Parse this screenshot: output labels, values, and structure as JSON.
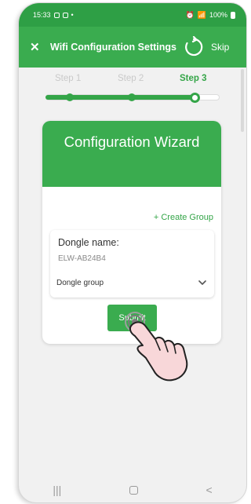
{
  "status_bar": {
    "time": "15:33",
    "battery": "100%"
  },
  "app_bar": {
    "title": "Wifi Configuration Settings",
    "close_icon": "close-icon",
    "refresh_icon": "refresh-icon",
    "skip_label": "Skip"
  },
  "stepper": {
    "steps": [
      {
        "label": "Step 1",
        "state": "done"
      },
      {
        "label": "Step 2",
        "state": "done"
      },
      {
        "label": "Step 3",
        "state": "current"
      }
    ],
    "progress": 0.87
  },
  "card": {
    "title": "Configuration Wizard",
    "create_group_label": "+ Create Group",
    "dongle_name_label": "Dongle name:",
    "dongle_name_value": "ELW-AB24B4",
    "dongle_group_label": "Dongle group",
    "submit_label": "Submit"
  },
  "colors": {
    "primary": "#3aac4f",
    "primary_dark": "#2e9f45",
    "text_muted": "#c9c9c9"
  },
  "nav_bar": {
    "recents_icon": "recents-icon",
    "home_icon": "home-icon",
    "back_icon": "back-icon"
  }
}
